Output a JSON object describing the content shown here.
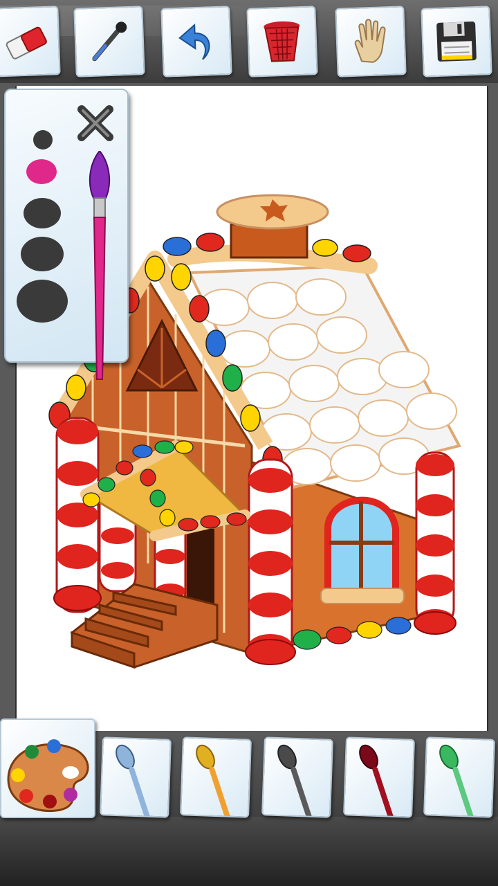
{
  "toolbar": {
    "tools": [
      {
        "name": "eraser-icon"
      },
      {
        "name": "eyedropper-icon"
      },
      {
        "name": "undo-icon"
      },
      {
        "name": "trash-icon"
      },
      {
        "name": "hand-icon"
      },
      {
        "name": "save-icon"
      }
    ]
  },
  "size_panel": {
    "sizes": [
      "small",
      "selected-medium",
      "large",
      "larger",
      "largest"
    ],
    "selected_color": "#e0288a",
    "dot_color": "#3a3a3a"
  },
  "brushes": [
    {
      "name": "blue-brush",
      "color": "#8fb4dc"
    },
    {
      "name": "orange-brush",
      "color": "#f0a030"
    },
    {
      "name": "gray-brush",
      "color": "#5a5a5a"
    },
    {
      "name": "darkred-brush",
      "color": "#8a1020"
    },
    {
      "name": "green-brush",
      "color": "#5cc880"
    }
  ],
  "palette": {
    "paint_colors": [
      "#1f8a3a",
      "#2a6fd8",
      "#ffd400",
      "#e0281e",
      "#a01010",
      "#b02aa0",
      "#ffffff"
    ]
  },
  "canvas": {
    "image": "gingerbread-house"
  }
}
